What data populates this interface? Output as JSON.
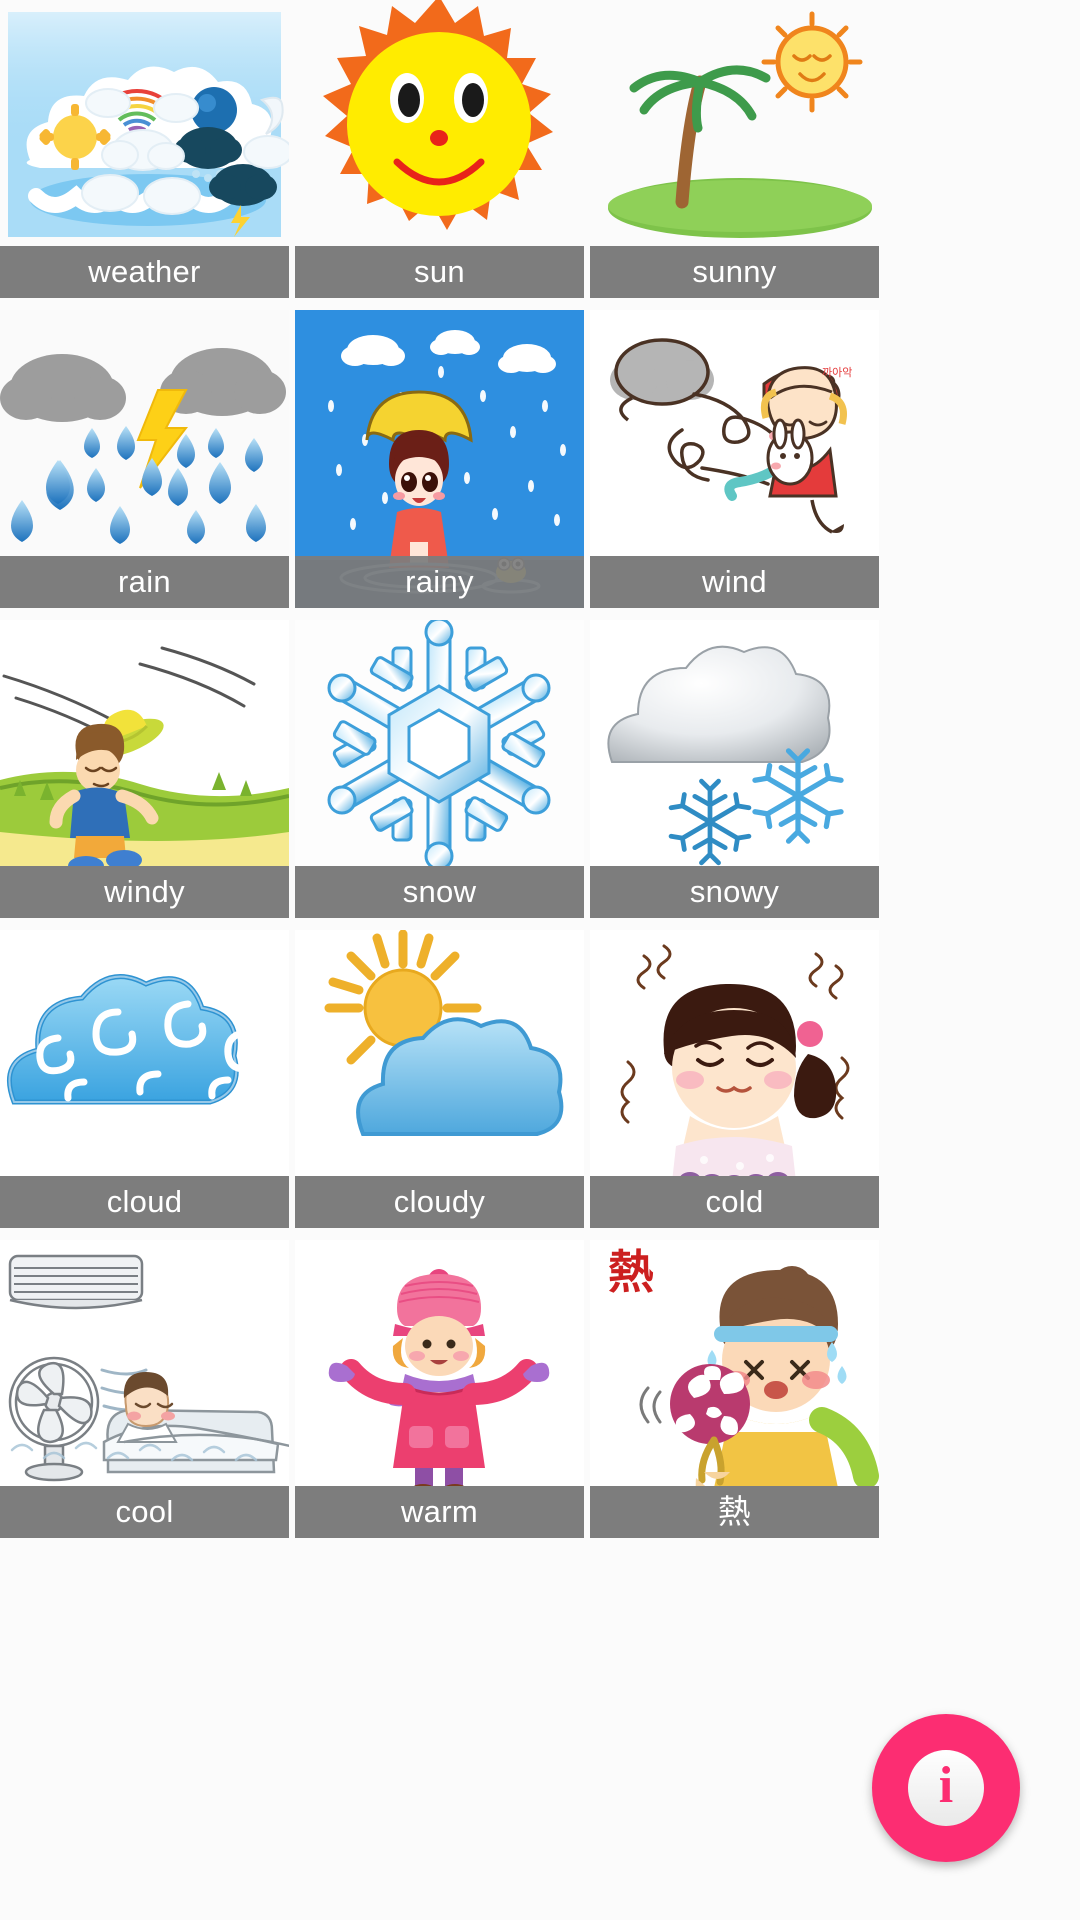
{
  "app": {
    "title": "Weather Vocabulary Flashcards",
    "background_color": "#fbfbfb",
    "label_bar_color": "#7d7d7d",
    "label_text_color": "#ffffff",
    "accent_color": "#fc2d72"
  },
  "grid": {
    "columns": 3,
    "rows": 5,
    "cells": [
      {
        "label": "weather",
        "art": "weather-collage",
        "fullbleed": false
      },
      {
        "label": "sun",
        "art": "sun-face",
        "fullbleed": false
      },
      {
        "label": "sunny",
        "art": "palm-island-sun",
        "fullbleed": false
      },
      {
        "label": "rain",
        "art": "storm-raindrops",
        "fullbleed": false
      },
      {
        "label": "rainy",
        "art": "girl-umbrella",
        "fullbleed": true
      },
      {
        "label": "wind",
        "art": "wind-blowing-girl",
        "fullbleed": false
      },
      {
        "label": "windy",
        "art": "boy-hat-blown",
        "fullbleed": false
      },
      {
        "label": "snow",
        "art": "snowflake-big",
        "fullbleed": false
      },
      {
        "label": "snowy",
        "art": "cloud-snowflakes",
        "fullbleed": false
      },
      {
        "label": "cloud",
        "art": "blue-cloud",
        "fullbleed": false
      },
      {
        "label": "cloudy",
        "art": "sun-behind-cloud",
        "fullbleed": false
      },
      {
        "label": "cold",
        "art": "girl-shivering",
        "fullbleed": false
      },
      {
        "label": "cool",
        "art": "fan-sleeping-boy",
        "fullbleed": false
      },
      {
        "label": "warm",
        "art": "girl-winter-coat",
        "fullbleed": false
      },
      {
        "label": "熱",
        "art": "girl-hot-fan",
        "fullbleed": false,
        "cjk": true
      }
    ]
  },
  "fab": {
    "icon": "info-icon",
    "glyph": "i",
    "color": "#fc2d72"
  }
}
